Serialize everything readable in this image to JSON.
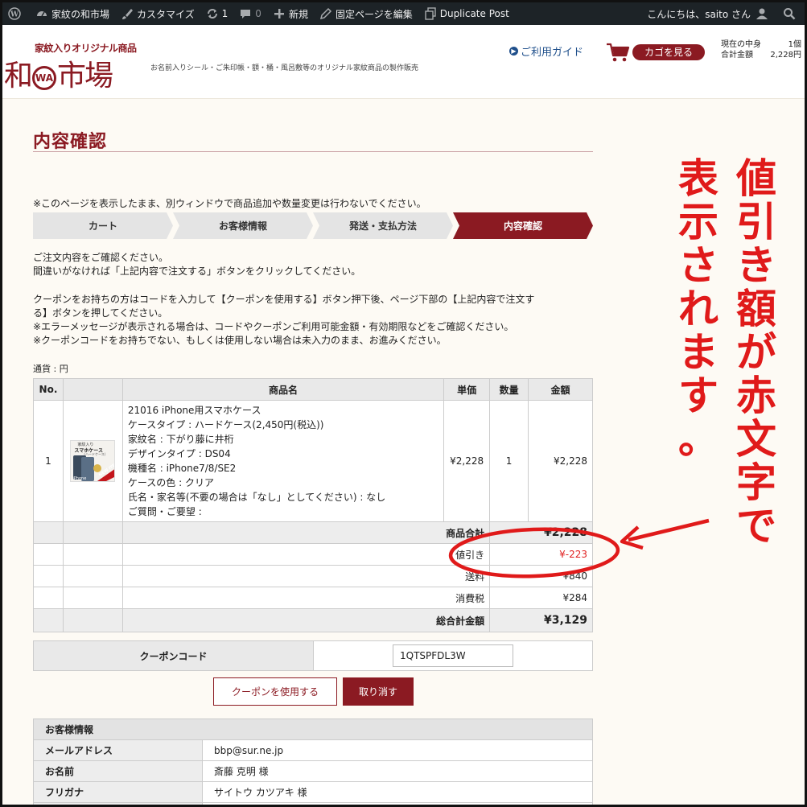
{
  "adminbar": {
    "site_name": "家紋の和市場",
    "customize": "カスタマイズ",
    "updates_count": "1",
    "comments_count": "0",
    "new_label": "新規",
    "edit_page": "固定ページを編集",
    "duplicate": "Duplicate Post",
    "greeting": "こんにちは、saito さん"
  },
  "header": {
    "logo_top": "家紋入りオリジナル商品",
    "logo_left": "和",
    "logo_wa": "WA",
    "logo_right": "市場",
    "tagline": "お名前入りシール・ご朱印帳・額・桶・風呂敷等のオリジナル家紋商品の製作販売",
    "guide": "ご利用ガイド",
    "cart_button": "カゴを見る",
    "cart_count_label": "現在の中身",
    "cart_count": "1個",
    "cart_total_label": "合計金額",
    "cart_total": "2,228円"
  },
  "page": {
    "title": "内容確認",
    "notice": "※このページを表示したまま、別ウィンドウで商品追加や数量変更は行わないでください。",
    "steps": [
      "カート",
      "お客様情報",
      "発送・支払方法",
      "内容確認"
    ],
    "intro": [
      "ご注文内容をご確認ください。",
      "間違いがなければ「上記内容で注文する」ボタンをクリックしてください。",
      "クーポンをお持ちの方はコードを入力して【クーポンを使用する】ボタン押下後、ページ下部の【上記内容で注文す",
      "る】ボタンを押してください。",
      "※エラーメッセージが表示される場合は、コードやクーポンご利用可能金額・有効期限などをご確認ください。",
      "※クーポンコードをお持ちでない、もしくは使用しない場合は未入力のまま、お進みください。"
    ],
    "currency": "通貨 : 円"
  },
  "table": {
    "headers": [
      "No.",
      "",
      "商品名",
      "単価",
      "数量",
      "金額"
    ],
    "item": {
      "no": "1",
      "thumb_text_1": "家紋入り",
      "thumb_text_2": "スマホケース",
      "thumb_text_3": "(ハードケース)",
      "thumb_badge": "NEW ITEM",
      "thumb_brand": "iPhone",
      "details": [
        "21016 iPhone用スマホケース",
        "ケースタイプ : ハードケース(2,450円(税込))",
        "家紋名 : 下がり藤に井桁",
        "デザインタイプ : DS04",
        "機種名 : iPhone7/8/SE2",
        "ケースの色 : クリア",
        "氏名・家名等(不要の場合は「なし」としてください) : なし",
        "ご質問・ご要望 :"
      ],
      "unit_price": "¥2,228",
      "qty": "1",
      "amount": "¥2,228"
    },
    "subtotal_label": "商品合計",
    "subtotal": "¥2,228",
    "discount_label": "値引き",
    "discount": "¥-223",
    "shipping_label": "送料",
    "shipping": "¥840",
    "tax_label": "消費税",
    "tax": "¥284",
    "total_label": "総合計金額",
    "total": "¥3,129"
  },
  "coupon": {
    "label": "クーポンコード",
    "value": "1QTSPFDL3W",
    "use_button": "クーポンを使用する",
    "cancel_button": "取り消す"
  },
  "customer": {
    "heading": "お客様情報",
    "rows": [
      {
        "key": "メールアドレス",
        "value": "bbp@sur.ne.jp"
      },
      {
        "key": "お名前",
        "value": "斎藤 克明 様"
      },
      {
        "key": "フリガナ",
        "value": "サイトウ カツアキ 様"
      }
    ]
  },
  "annotation": {
    "col1": [
      "値",
      "引",
      "き",
      "額",
      "が",
      "赤",
      "文",
      "字",
      "で"
    ],
    "col2": [
      "表",
      "示",
      "さ",
      "れ",
      "ま",
      "す",
      "。"
    ],
    "color": "#e01a1a"
  },
  "colors": {
    "brand": "#8b1a22",
    "adminbar": "#1d2327",
    "discount": "#e02020"
  }
}
